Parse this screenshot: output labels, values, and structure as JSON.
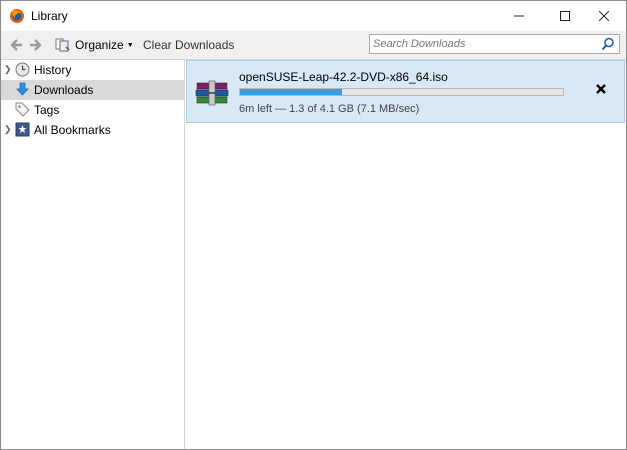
{
  "window": {
    "title": "Library"
  },
  "toolbar": {
    "organize_label": "Organize",
    "clear_label": "Clear Downloads",
    "search_placeholder": "Search Downloads"
  },
  "sidebar": {
    "items": [
      {
        "label": "History",
        "icon": "history-clock-icon",
        "expandable": true,
        "selected": false
      },
      {
        "label": "Downloads",
        "icon": "download-arrow-icon",
        "expandable": false,
        "selected": true
      },
      {
        "label": "Tags",
        "icon": "tag-icon",
        "expandable": false,
        "selected": false
      },
      {
        "label": "All Bookmarks",
        "icon": "bookmark-star-icon",
        "expandable": true,
        "selected": false
      }
    ]
  },
  "downloads": [
    {
      "filename": "openSUSE-Leap-42.2-DVD-x86_64.iso",
      "progress_fraction": 0.317,
      "status": "6m left — 1.3 of 4.1 GB (7.1 MB/sec)",
      "icon": "archive-books-icon"
    }
  ],
  "colors": {
    "progress": "#3b9ae1",
    "selected_row": "#d9e8f7",
    "sidebar_selected": "#d9d9d9"
  }
}
